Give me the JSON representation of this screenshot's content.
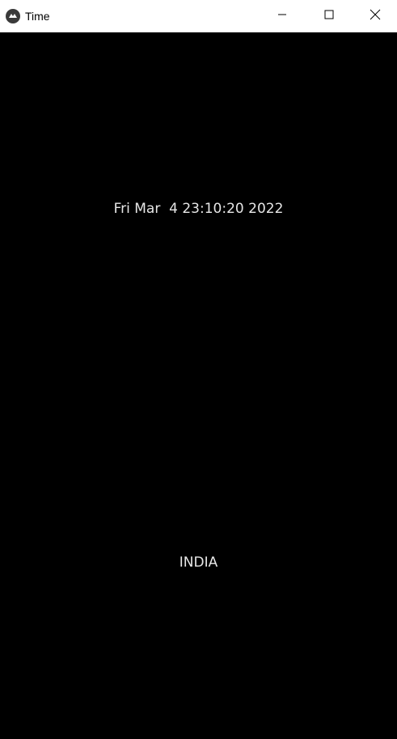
{
  "window": {
    "title": "Time",
    "app_icon": "kivy-logo-icon",
    "controls": [
      "minimize-icon",
      "maximize-icon",
      "close-icon"
    ]
  },
  "main": {
    "datetime_text": "Fri Mar  4 23:10:20 2022",
    "country_text": "INDIA"
  },
  "colors": {
    "background": "#000000",
    "titlebar": "#ffffff",
    "text": "#e6e6e6"
  }
}
